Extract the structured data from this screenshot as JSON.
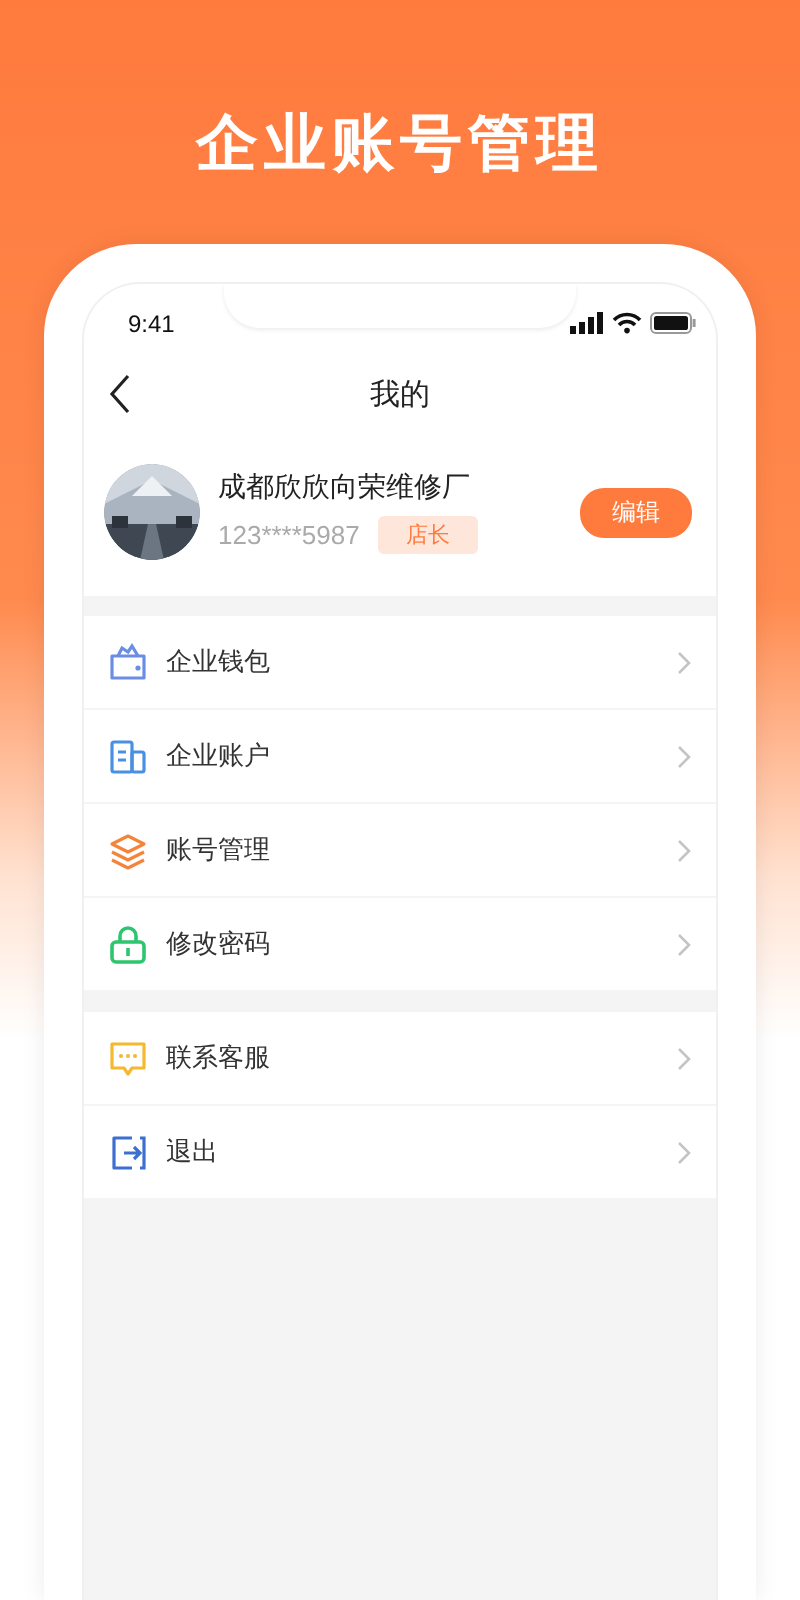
{
  "headline": "企业账号管理",
  "status_bar": {
    "time": "9:41"
  },
  "nav": {
    "title": "我的"
  },
  "profile": {
    "name": "成都欣欣向荣维修厂",
    "phone": "123****5987",
    "role": "店长",
    "edit": "编辑"
  },
  "menu_groups": [
    {
      "items": [
        {
          "kind": "wallet",
          "label": "企业钱包"
        },
        {
          "kind": "account",
          "label": "企业账户"
        },
        {
          "kind": "layers",
          "label": "账号管理"
        },
        {
          "kind": "lock",
          "label": "修改密码"
        }
      ]
    },
    {
      "items": [
        {
          "kind": "chat",
          "label": "联系客服"
        },
        {
          "kind": "logout",
          "label": "退出"
        }
      ]
    }
  ]
}
